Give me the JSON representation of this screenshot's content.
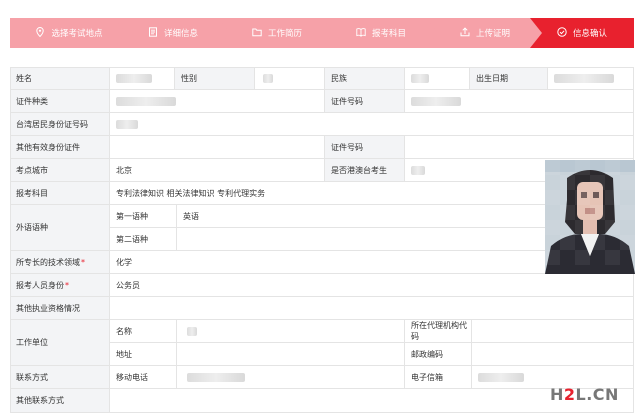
{
  "steps": [
    {
      "label": "选择考试地点",
      "icon": "location-pin-icon"
    },
    {
      "label": "详细信息",
      "icon": "document-icon"
    },
    {
      "label": "工作简历",
      "icon": "folder-icon"
    },
    {
      "label": "报考科目",
      "icon": "book-icon"
    },
    {
      "label": "上传证明",
      "icon": "upload-icon"
    },
    {
      "label": "信息确认",
      "icon": "check-circle-icon"
    }
  ],
  "active_step": 5,
  "colors": {
    "step_inactive": "#f6a1a8",
    "step_active": "#e8212e",
    "label_bg": "#f3f4f6"
  },
  "form": {
    "name_label": "姓名",
    "gender_label": "性别",
    "ethnicity_label": "民族",
    "birthdate_label": "出生日期",
    "id_type_label": "证件种类",
    "id_number_label": "证件号码",
    "taiwan_id_label": "台湾居民身份证号码",
    "other_id_label": "其他有效身份证件",
    "other_id_number_label": "证件号码",
    "exam_city_label": "考点城市",
    "exam_city_value": "北京",
    "hk_macao_tw_label": "是否港澳台考生",
    "subjects_label": "报考科目",
    "subjects_value": "专利法律知识 相关法律知识 专利代理实务",
    "foreign_lang_label": "外语语种",
    "first_lang_label": "第一语种",
    "first_lang_value": "英语",
    "second_lang_label": "第二语种",
    "tech_field_label": "所专长的技术领域",
    "tech_field_value": "化学",
    "applicant_status_label": "报考人员身份",
    "applicant_status_value": "公务员",
    "other_qual_label": "其他执业资格情况",
    "workplace_label": "工作单位",
    "wp_name_label": "名称",
    "agency_code_label": "所在代理机构代码",
    "address_label": "地址",
    "postcode_label": "邮政编码",
    "contact_label": "联系方式",
    "mobile_label": "移动电话",
    "email_label": "电子信箱",
    "other_contact_label": "其他联系方式"
  },
  "watermark": {
    "part1": "H",
    "part2": "2",
    "part3": "L.CN"
  }
}
